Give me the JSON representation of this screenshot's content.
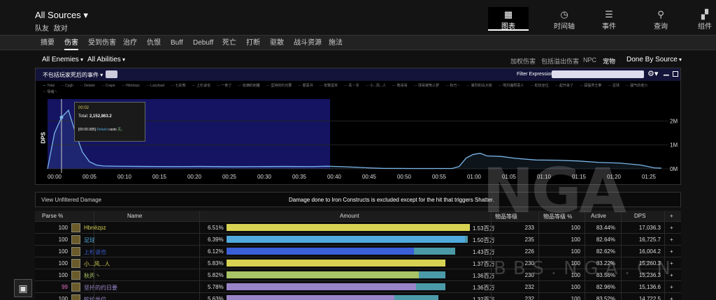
{
  "header": {
    "source": "All Sources",
    "sub_items": [
      "队友",
      "敌对"
    ],
    "views": [
      {
        "label": "图表",
        "icon": "grid-icon",
        "active": true
      },
      {
        "label": "时间轴",
        "icon": "clock-icon"
      },
      {
        "label": "事件",
        "icon": "list-icon"
      },
      {
        "label": "查询",
        "icon": "pin-icon"
      },
      {
        "label": "组件",
        "icon": "widgets-icon"
      }
    ]
  },
  "tabs": [
    "摘要",
    "伤害",
    "受到伤害",
    "治疗",
    "仇恨",
    "Buff",
    "Debuff",
    "死亡",
    "打断",
    "驱散",
    "战斗资源",
    "施法"
  ],
  "active_tab": "伤害",
  "filters": {
    "enemies": "All Enemies",
    "abilities": "All Abilities",
    "options": [
      "加权伤害",
      "包括溢出伤害",
      "NPC",
      "宠物"
    ],
    "selected_option": "宠物",
    "grouping": "Done By Source"
  },
  "chart_panel": {
    "event_select": "不包括玩家死后的事件",
    "filter_label": "Filter Expression:",
    "legend": [
      "Total",
      "Cygh",
      "Delaini",
      "Crape",
      "Hbnëzpz",
      "Lazyload",
      "七彩熊",
      "上杉谈也",
      "一条丁",
      "烧满的刺雕",
      "坚持的约日要",
      "罪恶书",
      "安赛蛋宋",
      "青丶寻",
      "小...风...人",
      "熊哥哥",
      "球哥被怖三梦",
      "秋巧丶",
      "暴烈的白大核",
      "明月魔照恶人",
      "蛇纹坐位",
      "起开来了",
      "囧猛界王拳",
      "足球",
      "骚气的老六",
      "情绪丶"
    ],
    "y_axis_label": "DPS"
  },
  "chart_data": {
    "type": "area",
    "x_ticks": [
      "00:00",
      "00:05",
      "00:10",
      "00:15",
      "00:20",
      "00:25",
      "00:30",
      "00:35",
      "00:40",
      "00:45",
      "00:50",
      "00:55",
      "01:00",
      "01:05",
      "01:10",
      "01:15",
      "01:20",
      "01:25"
    ],
    "y_ticks": [
      {
        "label": "2M",
        "value": 2000000
      },
      {
        "label": "1M",
        "value": 1000000
      },
      {
        "label": "0M",
        "value": 0
      }
    ],
    "xlim": [
      0,
      89
    ],
    "ylim": [
      0,
      2800000
    ],
    "selection": [
      0,
      40.5
    ],
    "series": [
      {
        "values": [
          [
            0,
            0
          ],
          [
            1,
            1500000
          ],
          [
            2,
            2150000
          ],
          [
            3,
            2450000
          ],
          [
            4,
            1500000
          ],
          [
            5,
            700000
          ],
          [
            6,
            300000
          ],
          [
            7,
            160000
          ],
          [
            8,
            120000
          ],
          [
            10,
            110000
          ],
          [
            14,
            100000
          ],
          [
            18,
            95000
          ],
          [
            22,
            100000
          ],
          [
            26,
            90000
          ],
          [
            30,
            95000
          ],
          [
            34,
            100000
          ],
          [
            38,
            95000
          ],
          [
            40,
            110000
          ],
          [
            42,
            95000
          ],
          [
            44,
            70000
          ],
          [
            46,
            40000
          ],
          [
            48,
            20000
          ],
          [
            52,
            15000
          ],
          [
            56,
            15000
          ],
          [
            58,
            15000
          ],
          [
            59,
            100000
          ],
          [
            60,
            450000
          ],
          [
            61,
            600000
          ],
          [
            62,
            650000
          ],
          [
            63,
            540000
          ],
          [
            65,
            520000
          ],
          [
            67,
            440000
          ],
          [
            70,
            370000
          ],
          [
            73,
            360000
          ],
          [
            76,
            330000
          ],
          [
            79,
            270000
          ],
          [
            82,
            240000
          ],
          [
            85,
            160000
          ],
          [
            87,
            40000
          ],
          [
            88,
            30000
          ]
        ]
      }
    ],
    "tooltip": {
      "time": "00:02",
      "total_label": "Total:",
      "total_value": "2,152,863.2",
      "cast_time": "[00:00.985]",
      "caster": "Delaini",
      "cast_verb": "casts",
      "spell": "灭。"
    }
  },
  "info": {
    "unfiltered": "View Unfiltered Damage",
    "note": "Damage done to Iron Constructs is excluded except for the hit that triggers Shatter."
  },
  "table": {
    "headers": [
      "Parse %",
      "Name",
      "Amount",
      "物品等级",
      "物品等级 %",
      "Active",
      "DPS",
      "+"
    ],
    "rows": [
      {
        "parse": "100",
        "name": "Hbnëzpz",
        "color": "#d7d252",
        "pct": "6.51%",
        "fill": 1.0,
        "fill_extra": 0.0,
        "amount": "1.53百万",
        "ilvl": "233",
        "ilvl_pct": "100",
        "active": "83.44%",
        "dps": "17,036.3",
        "plus": "+"
      },
      {
        "parse": "100",
        "name": "足球",
        "color": "#4fa9da",
        "pct": "6.39%",
        "fill": 0.98,
        "fill_extra": 0.01,
        "amount": "1.50百万",
        "ilvl": "235",
        "ilvl_pct": "100",
        "active": "82.64%",
        "dps": "16,725.7",
        "plus": "+"
      },
      {
        "parse": "100",
        "name": "上杉谈也",
        "color": "#3a5fd6",
        "pct": "6.12%",
        "fill": 0.77,
        "fill_extra": 0.17,
        "amount": "1.43百万",
        "ilvl": "226",
        "ilvl_pct": "100",
        "active": "82.62%",
        "dps": "16,004.2",
        "plus": "+"
      },
      {
        "parse": "100",
        "name": "小...风...人",
        "color": "#d7d252",
        "pct": "5.83%",
        "fill": 0.9,
        "fill_extra": 0.0,
        "amount": "1.37百万",
        "ilvl": "230",
        "ilvl_pct": "100",
        "active": "83.22%",
        "dps": "15,260.3",
        "plus": "+"
      },
      {
        "parse": "100",
        "name": "秋丙丶",
        "color": "#a8c466",
        "pct": "5.82%",
        "fill": 0.79,
        "fill_extra": 0.11,
        "amount": "1.36百万",
        "ilvl": "230",
        "ilvl_pct": "100",
        "active": "83.56%",
        "dps": "15,236.3",
        "plus": "+"
      },
      {
        "parse": "99",
        "name": "坚持的约日要",
        "color": "#9a84c8",
        "pct": "5.78%",
        "fill": 0.78,
        "fill_extra": 0.12,
        "amount": "1.36百万",
        "ilvl": "232",
        "ilvl_pct": "100",
        "active": "82.96%",
        "dps": "15,136.6",
        "plus": "+"
      },
      {
        "parse": "100",
        "name": "蛇纹坐位",
        "color": "#9a84c8",
        "pct": "5.63%",
        "fill": 0.69,
        "fill_extra": 0.18,
        "amount": "1.32百万",
        "ilvl": "232",
        "ilvl_pct": "100",
        "active": "83.52%",
        "dps": "14,722.5",
        "plus": "+"
      }
    ]
  },
  "watermark": {
    "logo": "NGA",
    "site": "BBS.NGA.CN"
  }
}
